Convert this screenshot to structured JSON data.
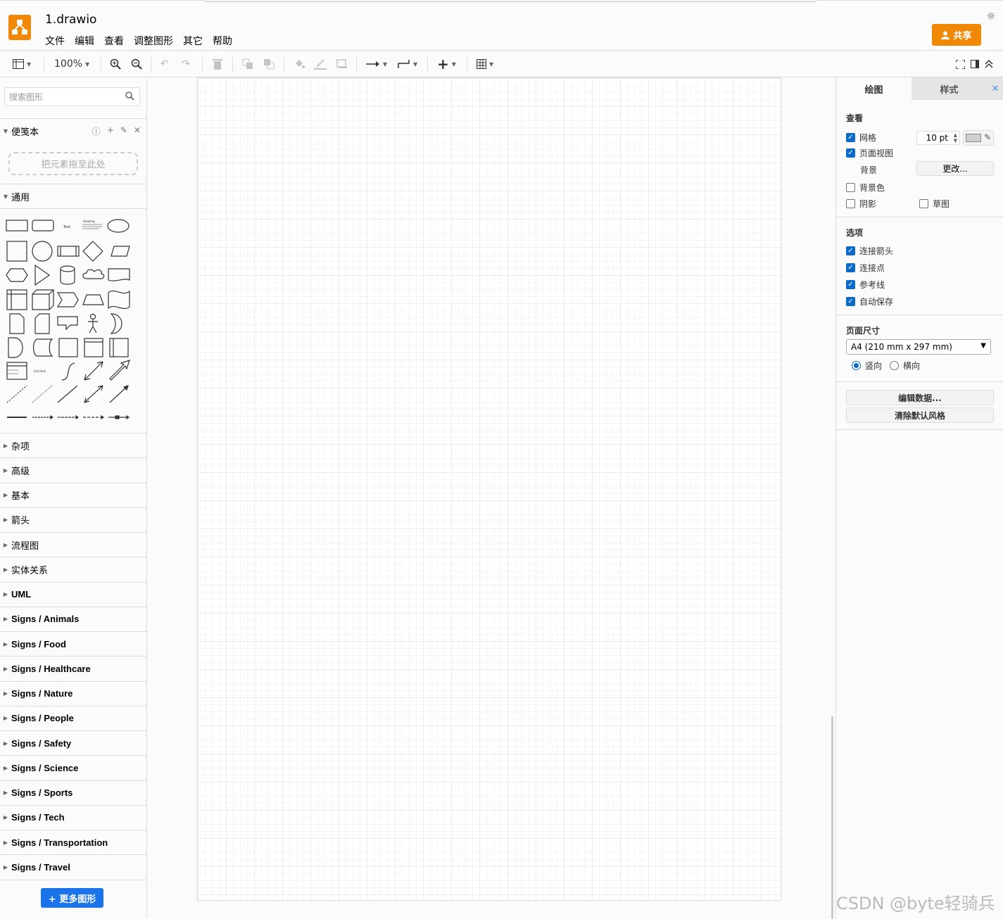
{
  "app": {
    "doc_title": "1.drawio",
    "menus": [
      "文件",
      "编辑",
      "查看",
      "调整图形",
      "其它",
      "帮助"
    ],
    "share_label": "共享",
    "accent": "#f08705"
  },
  "toolbar": {
    "zoom": "100%",
    "icons": [
      "format-panel-icon",
      "zoom-in-icon",
      "zoom-out-icon",
      "undo-icon",
      "redo-icon",
      "delete-icon",
      "to-front-icon",
      "to-back-icon",
      "fill-color-icon",
      "line-color-icon",
      "shadow-icon",
      "connection-icon",
      "waypoints-icon",
      "insert-icon",
      "table-icon",
      "fullscreen-icon",
      "format-toggle-icon",
      "collapse-icon"
    ]
  },
  "sidebar": {
    "search_placeholder": "搜索图形",
    "scratchpad_title": "便笺本",
    "drop_hint": "把元素拖至此处",
    "general_title": "通用",
    "categories": [
      "杂项",
      "高级",
      "基本",
      "箭头",
      "流程图",
      "实体关系",
      "UML",
      "Signs / Animals",
      "Signs / Food",
      "Signs / Healthcare",
      "Signs / Nature",
      "Signs / People",
      "Signs / Safety",
      "Signs / Science",
      "Signs / Sports",
      "Signs / Tech",
      "Signs / Transportation",
      "Signs / Travel"
    ],
    "more_shapes": "+ 更多图形",
    "shape_text_1": "Text",
    "shape_text_2": "Heading",
    "shape_text_3": "List Item"
  },
  "panel": {
    "tab_diagram": "绘图",
    "tab_style": "样式",
    "close": "✕",
    "view_title": "查看",
    "grid_label": "网格",
    "grid_checked": true,
    "grid_size": "10 pt",
    "page_view_label": "页面视图",
    "page_view_checked": true,
    "background_label": "背景",
    "background_change": "更改...",
    "bg_color_label": "背景色",
    "bg_color_checked": false,
    "shadow_label": "阴影",
    "shadow_checked": false,
    "sketch_label": "草图",
    "sketch_checked": false,
    "options_title": "选项",
    "options": [
      {
        "label": "连接箭头",
        "checked": true
      },
      {
        "label": "连接点",
        "checked": true
      },
      {
        "label": "参考线",
        "checked": true
      },
      {
        "label": "自动保存",
        "checked": true
      }
    ],
    "page_size_title": "页面尺寸",
    "page_size_value": "A4 (210 mm x 297 mm)",
    "portrait_label": "竖向",
    "landscape_label": "横向",
    "orientation": "portrait",
    "edit_data": "编辑数据...",
    "clear_style": "清除默认风格"
  },
  "watermark": "CSDN @byte轻骑兵"
}
